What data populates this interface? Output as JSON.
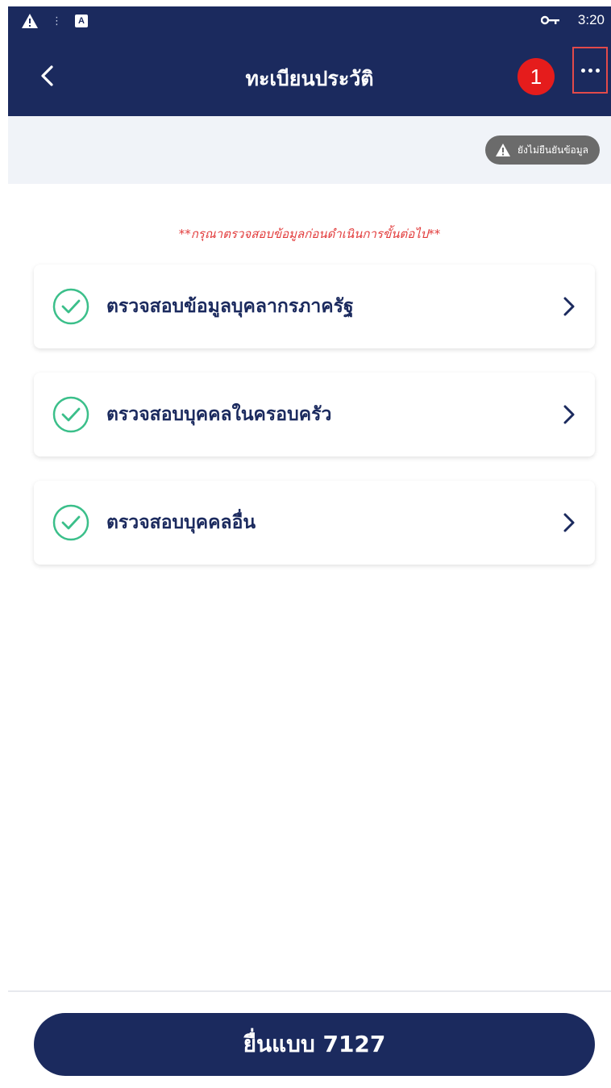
{
  "status_bar": {
    "time": "3:20",
    "icons": [
      "warning-icon",
      "notification-dot-icon",
      "a-icon",
      "key-icon"
    ]
  },
  "app_bar": {
    "title": "ทะเบียนประวัติ",
    "notification_count": "1",
    "back_icon": "chevron-left-icon",
    "more_icon": "more-dots-icon"
  },
  "status_badge": {
    "text": "ยังไม่ยืนยันข้อมูล",
    "icon": "warning-icon"
  },
  "notice": "**กรุณาตรวจสอบข้อมูลก่อนดำเนินการขั้นต่อไป**",
  "checklist": [
    {
      "label": "ตรวจสอบข้อมูลบุคลากรภาครัฐ",
      "status": "checked"
    },
    {
      "label": "ตรวจสอบบุคคลในครอบครัว",
      "status": "checked"
    },
    {
      "label": "ตรวจสอบบุคคลอื่น",
      "status": "checked"
    }
  ],
  "submit_button": "ยื่นแบบ 7127",
  "colors": {
    "primary": "#1b2a5e",
    "check": "#3bbf8a",
    "notice": "#e23b3b",
    "badge": "#e51c1c"
  }
}
